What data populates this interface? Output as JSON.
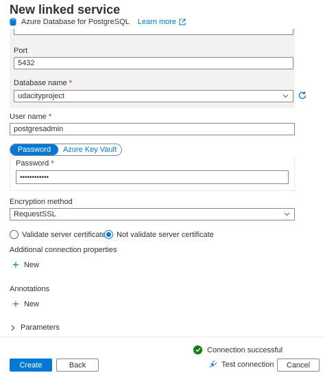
{
  "header": {
    "title": "New linked service",
    "service_type": "Azure Database for PostgreSQL",
    "learn_more": "Learn more"
  },
  "form": {
    "port_label": "Port",
    "port_value": "5432",
    "database_label": "Database name",
    "database_value": "udacityproject",
    "required_mark": "*",
    "username_label": "User name",
    "username_value": "postgresadmin",
    "auth_tabs": {
      "password": "Password",
      "key_vault": "Azure Key Vault"
    },
    "password_label": "Password",
    "password_value": "••••••••••••",
    "encryption_label": "Encryption method",
    "encryption_value": "RequestSSL",
    "radio_validate": "Validate server certificate",
    "radio_not_validate": "Not validate server certificate",
    "additional_props_label": "Additional connection properties",
    "new_label": "New",
    "annotations_label": "Annotations",
    "parameters_label": "Parameters"
  },
  "footer": {
    "status": "Connection successful",
    "create": "Create",
    "back": "Back",
    "test_connection": "Test connection",
    "cancel": "Cancel"
  },
  "colors": {
    "accent": "#0078d4",
    "success": "#107c10",
    "required": "#a4262c"
  }
}
